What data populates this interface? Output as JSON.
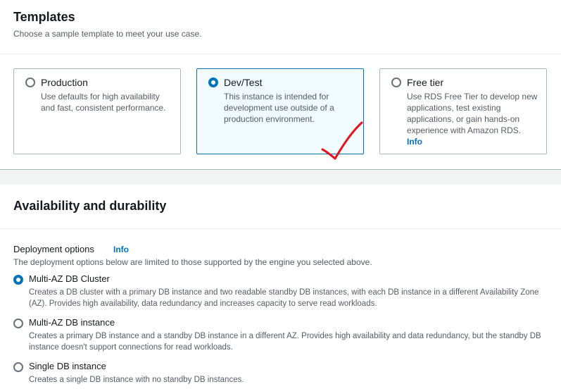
{
  "templates": {
    "title": "Templates",
    "subtitle": "Choose a sample template to meet your use case.",
    "cards": [
      {
        "title": "Production",
        "description": "Use defaults for high availability and fast, consistent performance.",
        "selected": false
      },
      {
        "title": "Dev/Test",
        "description": "This instance is intended for development use outside of a production environment.",
        "selected": true
      },
      {
        "title": "Free tier",
        "description": "Use RDS Free Tier to develop new applications, test existing applications, or gain hands-on experience with Amazon RDS.",
        "info": "Info",
        "selected": false
      }
    ]
  },
  "availability": {
    "title": "Availability and durability",
    "deployment_label": "Deployment options",
    "deployment_info": "Info",
    "deployment_desc": "The deployment options below are limited to those supported by the engine you selected above.",
    "options": [
      {
        "title": "Multi-AZ DB Cluster",
        "description": "Creates a DB cluster with a primary DB instance and two readable standby DB instances, with each DB instance in a different Availability Zone (AZ). Provides high availability, data redundancy and increases capacity to serve read workloads.",
        "selected": true
      },
      {
        "title": "Multi-AZ DB instance",
        "description": "Creates a primary DB instance and a standby DB instance in a different AZ. Provides high availability and data redundancy, but the standby DB instance doesn't support connections for read workloads.",
        "selected": false
      },
      {
        "title": "Single DB instance",
        "description": "Creates a single DB instance with no standby DB instances.",
        "selected": false
      }
    ]
  },
  "colors": {
    "accent": "#0073bb",
    "annotation": "#e8111b"
  }
}
